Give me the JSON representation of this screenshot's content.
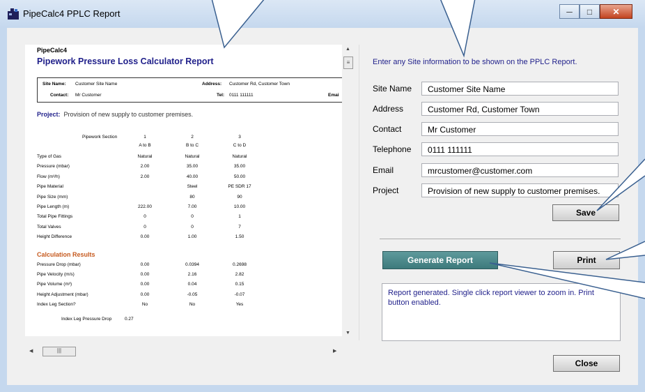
{
  "window": {
    "title": "PipeCalc4 PPLC Report"
  },
  "report": {
    "app": "PipeCalc4",
    "title": "Pipework Pressure Loss Calculator Report",
    "site_name_label": "Site Name:",
    "site_name": "Customer Site Name",
    "address_label": "Address:",
    "address": "Customer Rd, Customer Town",
    "contact_label": "Contact:",
    "contact": "Mr Customer",
    "tel_label": "Tel:",
    "tel": "0111 111111",
    "email_label": "Emai",
    "project_label": "Project:",
    "project": "Provision of new supply to customer premises.",
    "section_header": "Pipework Section",
    "sections": [
      "1",
      "2",
      "3"
    ],
    "section_names": [
      "A to B",
      "B to C",
      "C to D"
    ],
    "rows": [
      {
        "label": "Type of Gas",
        "values": [
          "Natural",
          "Natural",
          "Natural"
        ]
      },
      {
        "label": "Pressure (mbar)",
        "values": [
          "2.00",
          "35.00",
          "35.00"
        ]
      },
      {
        "label": "Flow (m³/h)",
        "values": [
          "2.00",
          "40.00",
          "50.00"
        ]
      },
      {
        "label": "Pipe Material",
        "values": [
          "",
          "Steel",
          "PE SDR 17"
        ]
      },
      {
        "label": "Pipe Size (mm)",
        "values": [
          "",
          "80",
          "90"
        ]
      },
      {
        "label": "Pipe Length (m)",
        "values": [
          "222.00",
          "7.00",
          "10.00"
        ]
      },
      {
        "label": "Total Pipe Fittings",
        "values": [
          "0",
          "0",
          "1"
        ]
      },
      {
        "label": "Total Valves",
        "values": [
          "0",
          "0",
          "7"
        ]
      },
      {
        "label": "Height Difference",
        "values": [
          "0.00",
          "1.00",
          "1.50"
        ]
      }
    ],
    "calc_header": "Calculation Results",
    "calc_rows": [
      {
        "label": "Pressure Drop (mbar)",
        "values": [
          "0.00",
          "0.0394",
          "0.2698"
        ]
      },
      {
        "label": "Pipe Velocity (m/s)",
        "values": [
          "0.00",
          "2.16",
          "2.82"
        ]
      },
      {
        "label": "Pipe Volume (m³)",
        "values": [
          "0.00",
          "0.04",
          "0.15"
        ]
      },
      {
        "label": "Height Adjustment (mbar)",
        "values": [
          "0.00",
          "-0.05",
          "-0.07"
        ]
      },
      {
        "label": "Index Leg Section?",
        "values": [
          "No",
          "No",
          "Yes"
        ]
      }
    ],
    "index_leg_label": "Index Leg Pressure Drop",
    "index_leg_value": "0.27"
  },
  "site_form": {
    "intro": "Enter any Site information to be shown on the PPLC Report.",
    "fields": [
      {
        "label": "Site Name",
        "value": "Customer Site Name"
      },
      {
        "label": "Address",
        "value": "Customer Rd, Customer Town"
      },
      {
        "label": "Contact",
        "value": "Mr Customer"
      },
      {
        "label": "Telephone",
        "value": "0111 111111"
      },
      {
        "label": "Email",
        "value": "mrcustomer@customer.com"
      },
      {
        "label": "Project",
        "value": "Provision of new supply to customer premises."
      }
    ],
    "save_label": "Save"
  },
  "actions": {
    "generate_label": "Generate Report",
    "print_label": "Print",
    "close_label": "Close"
  },
  "status": {
    "text": "Report generated.  Single click report viewer to zoom in. Print button enabled."
  },
  "colors": {
    "accent_title": "#1f1f8a",
    "calc_header": "#c65a1f",
    "generate_button": "#4a8a8c"
  }
}
